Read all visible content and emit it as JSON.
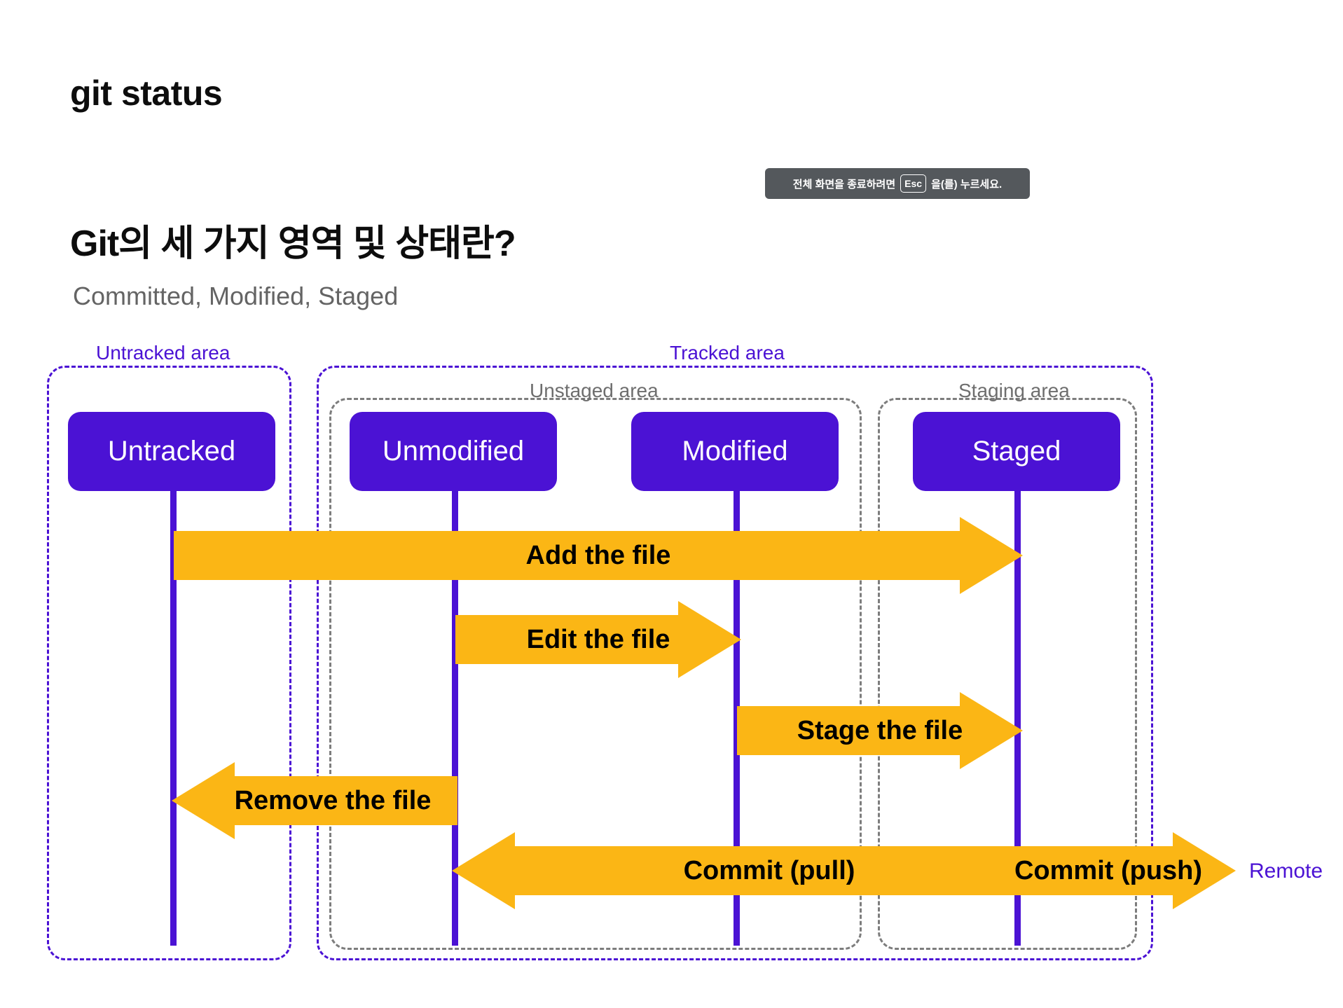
{
  "slide": {
    "title": "git status",
    "heading": "Git의 세 가지 영역 및 상태란?",
    "subheading": "Committed, Modified, Staged"
  },
  "toast": {
    "prefix": "전체 화면을 종료하려면",
    "key": "Esc",
    "suffix": "을(를) 누르세요."
  },
  "colors": {
    "purple": "#4b12d4",
    "yellow": "#fbb615",
    "gray": "#7d7d7d",
    "toast_bg": "#54585c",
    "text": "#0d0d0d",
    "subtext": "#646464"
  },
  "diagram": {
    "areas": [
      {
        "name": "untracked-area",
        "label": "Untracked area",
        "color": "purple"
      },
      {
        "name": "tracked-area",
        "label": "Tracked area",
        "color": "purple"
      },
      {
        "name": "unstaged-area",
        "label": "Unstaged area",
        "color": "gray"
      },
      {
        "name": "staging-area",
        "label": "Staging area",
        "color": "gray"
      }
    ],
    "states": [
      {
        "name": "untracked",
        "label": "Untracked"
      },
      {
        "name": "unmodified",
        "label": "Unmodified"
      },
      {
        "name": "modified",
        "label": "Modified"
      },
      {
        "name": "staged",
        "label": "Staged"
      }
    ],
    "transitions": [
      {
        "name": "add-the-file",
        "label": "Add the file",
        "direction": "right",
        "from": "untracked",
        "to": "staged"
      },
      {
        "name": "edit-the-file",
        "label": "Edit the file",
        "direction": "right",
        "from": "unmodified",
        "to": "modified"
      },
      {
        "name": "stage-the-file",
        "label": "Stage the file",
        "direction": "right",
        "from": "modified",
        "to": "staged"
      },
      {
        "name": "remove-the-file",
        "label": "Remove the file",
        "direction": "left",
        "from": "unmodified",
        "to": "untracked"
      },
      {
        "name": "commit-pull",
        "label": "Commit (pull)",
        "direction": "left",
        "from": "staged",
        "to": "unmodified"
      },
      {
        "name": "commit-push",
        "label": "Commit (push)",
        "direction": "right",
        "from": "staged",
        "to": "remote"
      }
    ],
    "remote_label": "Remote"
  }
}
